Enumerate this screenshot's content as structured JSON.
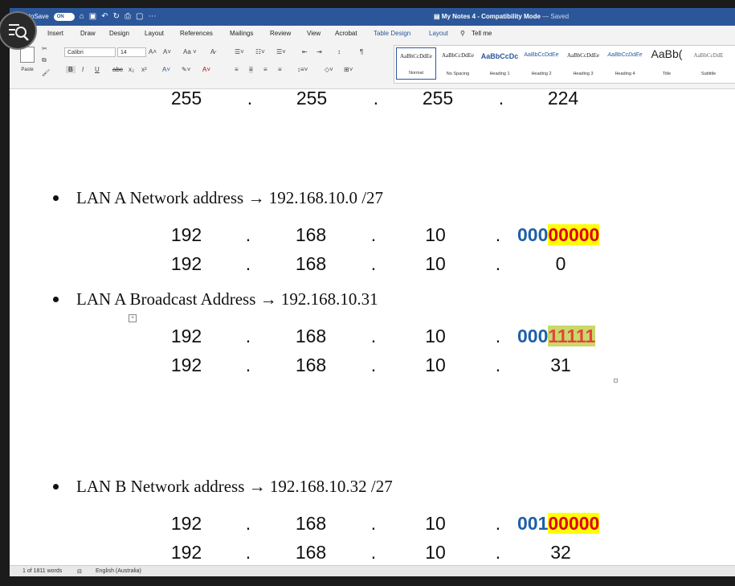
{
  "titlebar": {
    "autosave_label": "AutoSave",
    "autosave_state": "ON",
    "doc_title": "My Notes 4",
    "doc_mode": " - Compatibility Mode",
    "doc_status": " — Saved"
  },
  "menu": {
    "insert": "Insert",
    "draw": "Draw",
    "design": "Design",
    "layout": "Layout",
    "references": "References",
    "mailings": "Mailings",
    "review": "Review",
    "view": "View",
    "acrobat": "Acrobat",
    "table_design": "Table Design",
    "table_layout": "Layout",
    "tell_me": "Tell me"
  },
  "ribbon": {
    "paste_label": "Paste",
    "font_name": "Calibri",
    "font_size": "14",
    "bold": "B",
    "italic": "I",
    "underline": "U",
    "strike": "abc",
    "subscript": "x₂",
    "superscript": "x²",
    "styles": [
      {
        "sample": "AaBbCcDdEe",
        "name": "Normal"
      },
      {
        "sample": "AaBbCcDdEe",
        "name": "No Spacing"
      },
      {
        "sample": "AaBbCcDc",
        "name": "Heading 1"
      },
      {
        "sample": "AaBbCcDdEe",
        "name": "Heading 2"
      },
      {
        "sample": "AaBbCcDdEe",
        "name": "Heading 3"
      },
      {
        "sample": "AaBbCcDdEe",
        "name": "Heading 4"
      },
      {
        "sample": "AaBb(",
        "name": "Title"
      },
      {
        "sample": "AaBbCcDdE",
        "name": "Subtitle"
      }
    ]
  },
  "document": {
    "top_mask": {
      "o1": "255",
      "d1": ".",
      "o2": "255",
      "d2": ".",
      "o3": "255",
      "d3": ".",
      "o4": "224"
    },
    "lan_a_network": {
      "bullet": "LAN A Network address → 192.168.10.0 /27",
      "binary_row": {
        "o1": "192",
        "o2": "168",
        "o3": "10",
        "bin_blue": "000",
        "bin_hl": "00000"
      },
      "decimal_row": {
        "o1": "192",
        "o2": "168",
        "o3": "10",
        "o4": "0"
      }
    },
    "lan_a_broadcast": {
      "bullet": "LAN A Broadcast Address → 192.168.10.31",
      "binary_row": {
        "o1": "192",
        "o2": "168",
        "o3": "10",
        "bin_blue": "000",
        "bin_hl": "11111"
      },
      "decimal_row": {
        "o1": "192",
        "o2": "168",
        "o3": "10",
        "o4": "31"
      }
    },
    "lan_b_network": {
      "bullet": "LAN B Network address → 192.168.10.32 /27",
      "binary_row": {
        "o1": "192",
        "o2": "168",
        "o3": "10",
        "bin_blue": "001",
        "bin_hl": "00000"
      },
      "decimal_row": {
        "o1": "192",
        "o2": "168",
        "o3": "10",
        "o4": "32"
      }
    },
    "dot": "."
  },
  "status": {
    "word_count": "1 of 1811 words",
    "language": "English (Australia)"
  },
  "colors": {
    "word_blue": "#2b579a",
    "binary_blue": "#1f5fa8",
    "binary_red": "#e0001a",
    "highlight_yellow": "#ffff00",
    "highlight_green": "#c9d86a"
  }
}
